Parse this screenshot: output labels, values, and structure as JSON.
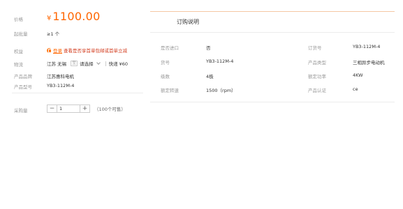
{
  "product": {
    "price_label": "价格",
    "currency": "¥",
    "price": "1100.00",
    "min_qty_label": "起批量",
    "min_qty": "≥1 个",
    "benefit_label": "权益",
    "benefit_link": "登录",
    "benefit_text": "查看是否享首单包邮或首单立减",
    "shipping_label": "物流",
    "ship_from": "江苏 无锡",
    "to_label": "至",
    "ship_to_placeholder": "请选择",
    "express": "快递 ¥60",
    "brand_label": "产品品牌",
    "brand": "江苏惠科电机",
    "model_label": "产品型号",
    "model": "YB3-112M-4",
    "quantity_label": "采购量",
    "quantity_value": "1",
    "stock_text": "（100个可售）",
    "minus": "−",
    "plus": "+"
  },
  "specs": {
    "tab_label": "订购说明",
    "rows": [
      {
        "k1": "是否进口",
        "v1": "否",
        "k2": "订货号",
        "v2": "YB3-112M-4"
      },
      {
        "k1": "货号",
        "v1": "YB3-112M-4",
        "k2": "产品类型",
        "v2": "三相异步电动机"
      },
      {
        "k1": "级数",
        "v1": "4极",
        "k2": "额定功率",
        "v2": "4KW"
      },
      {
        "k1": "额定转速",
        "v1": "1500（rpm）",
        "k2": "产品认证",
        "v2": "ce"
      }
    ]
  },
  "colors": {
    "accent": "#ff6600",
    "label_gray": "#999999",
    "divider": "#ececec"
  }
}
